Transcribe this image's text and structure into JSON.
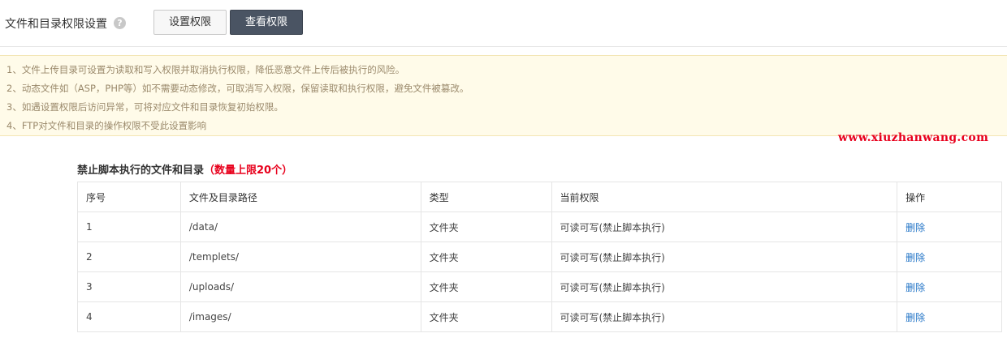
{
  "header": {
    "title": "文件和目录权限设置",
    "help_icon": "question-circle-icon",
    "buttons": {
      "set": "设置权限",
      "view": "查看权限"
    }
  },
  "notice": [
    "1、文件上传目录可设置为读取和写入权限并取消执行权限，降低恶意文件上传后被执行的风险。",
    "2、动态文件如（ASP，PHP等）如不需要动态修改，可取消写入权限，保留读取和执行权限，避免文件被篡改。",
    "3、如遇设置权限后访问异常，可将对应文件和目录恢复初始权限。",
    "4、FTP对文件和目录的操作权限不受此设置影响"
  ],
  "watermark": "www.xiuzhanwang.com",
  "section": {
    "title": "禁止脚本执行的文件和目录",
    "limit": "（数量上限20个）"
  },
  "table": {
    "headers": [
      "序号",
      "文件及目录路径",
      "类型",
      "当前权限",
      "操作"
    ],
    "rows": [
      {
        "index": "1",
        "path": "/data/",
        "type": "文件夹",
        "perm": "可读可写(禁止脚本执行)",
        "action": "删除"
      },
      {
        "index": "2",
        "path": "/templets/",
        "type": "文件夹",
        "perm": "可读可写(禁止脚本执行)",
        "action": "删除"
      },
      {
        "index": "3",
        "path": "/uploads/",
        "type": "文件夹",
        "perm": "可读可写(禁止脚本执行)",
        "action": "删除"
      },
      {
        "index": "4",
        "path": "/images/",
        "type": "文件夹",
        "perm": "可读可写(禁止脚本执行)",
        "action": "删除"
      }
    ]
  },
  "colors": {
    "accent_dark": "#4a5463",
    "warning_red": "#e8001c",
    "link_blue": "#2475c7",
    "notice_bg": "#fffbe9"
  }
}
